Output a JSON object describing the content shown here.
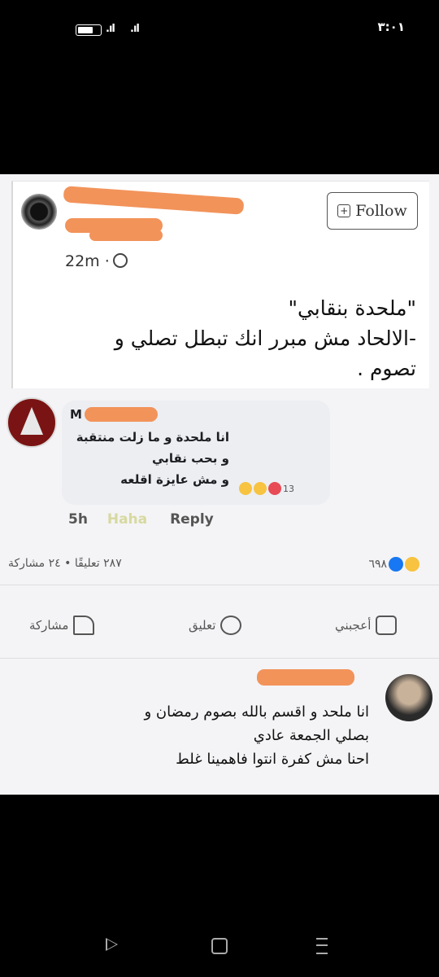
{
  "status_bar": {
    "signal_1": ".ıl",
    "signal_2": ".ıl",
    "clock": "٣:٠١"
  },
  "post": {
    "follow_label": "Follow",
    "time": "22m ·",
    "text_lines": [
      "\"ملحدة بنقابي\"",
      "-الالحاد مش مبرر انك تبطل تصلي و",
      "تصوم ."
    ]
  },
  "comment": {
    "name": "M",
    "text_lines": [
      "انا ملحدة و ما زلت منتقبة",
      "و بحب نقابي",
      "و مش عايزة اقلعه"
    ],
    "reaction_count": "13",
    "time": "5h",
    "haha_label": "Haha",
    "reply_label": "Reply"
  },
  "summary": {
    "counts_text": "٢٨٧ تعليقًا • ٢٤ مشاركة",
    "reactions_count": "٦٩٨"
  },
  "actions": {
    "like": "أعجبني",
    "comment": "تعليق",
    "share": "مشاركة"
  },
  "reply_comment": {
    "text_lines": [
      "انا ملحد و اقسم بالله بصوم رمضان و",
      "بصلي الجمعة عادي",
      "احنا مش كفرة انتوا فاهمينا غلط"
    ]
  },
  "colors": {
    "redaction": "#f2935a",
    "facebook_blue": "#1877f2"
  }
}
